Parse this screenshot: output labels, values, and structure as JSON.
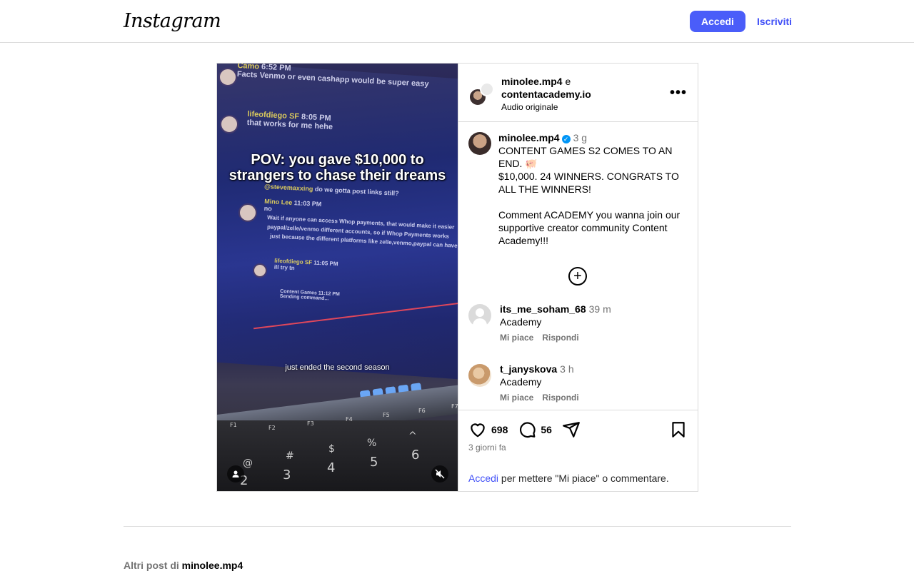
{
  "header": {
    "logo": "Instagram",
    "login_button": "Accedi",
    "signup_link": "Iscriviti"
  },
  "media": {
    "overlay_title": "POV: you gave $10,000 to strangers to chase their dreams",
    "overlay_caption": "just ended the second season",
    "chat": [
      {
        "name": "Camo",
        "time": "6:52 PM",
        "text": "Facts Venmo or even cashapp would be super easy"
      },
      {
        "name": "lifeofdiego SF",
        "time": "8:05 PM",
        "text": "that works for me hehe"
      },
      {
        "name": "@stevemaxxing",
        "time": "",
        "text": "do we gotta post links still?"
      },
      {
        "name": "Mino Lee",
        "time": "11:03 PM",
        "text": "no"
      },
      {
        "name": "",
        "time": "",
        "text": "Wait if anyone can access Whop payments, that would make it easier"
      },
      {
        "name": "",
        "time": "",
        "text": "paypal/zelle/venmo different accounts, so if Whop Payments works"
      },
      {
        "name": "",
        "time": "",
        "text": "just because the different platforms like zelle,venmo,paypal can have"
      },
      {
        "name": "lifeofdiego SF",
        "time": "11:05 PM",
        "text": "ill try tn"
      },
      {
        "name": "Content Games",
        "time": "11:12 PM",
        "text": "Sending command..."
      }
    ],
    "keys": [
      "F1",
      "F2",
      "F3",
      "F4",
      "F5",
      "F6",
      "F7",
      "@",
      "#",
      "$",
      "%",
      "^",
      "2",
      "3",
      "4",
      "5",
      "6"
    ]
  },
  "post_header": {
    "user1": "minolee.mp4",
    "conj": " e",
    "user2": "contentacademy.io",
    "audio": "Audio originale"
  },
  "caption": {
    "username": "minolee.mp4",
    "time": "3 g",
    "body": "CONTENT GAMES S2 COMES TO AN END. 🐖\n$10,000. 24 WINNERS. CONGRATS TO ALL THE WINNERS!\n\nComment ACADEMY you wanna join our supportive creator community Content Academy!!!"
  },
  "comments": [
    {
      "username": "its_me_soham_68",
      "time": "39 m",
      "text": "Academy",
      "like": "Mi piace",
      "reply": "Rispondi"
    },
    {
      "username": "t_janyskova",
      "time": "3 h",
      "text": "Academy",
      "like": "Mi piace",
      "reply": "Rispondi"
    }
  ],
  "actions": {
    "likes": "698",
    "comments": "56",
    "date": "3 giorni fa",
    "login_link": "Accedi",
    "login_text": " per mettere \"Mi piace\" o commentare."
  },
  "footer": {
    "more_prefix": "Altri post di ",
    "more_user": "minolee.mp4"
  },
  "colors": {
    "accent": "#4a5df9",
    "link": "#4150f7",
    "border": "#dbdbdb",
    "secondary_text": "#737373",
    "verified": "#0095f6"
  },
  "icons": [
    "heart-icon",
    "comment-icon",
    "share-icon",
    "bookmark-icon",
    "more-icon",
    "plus-circle-icon",
    "verified-icon",
    "user-tag-icon",
    "muted-icon"
  ]
}
